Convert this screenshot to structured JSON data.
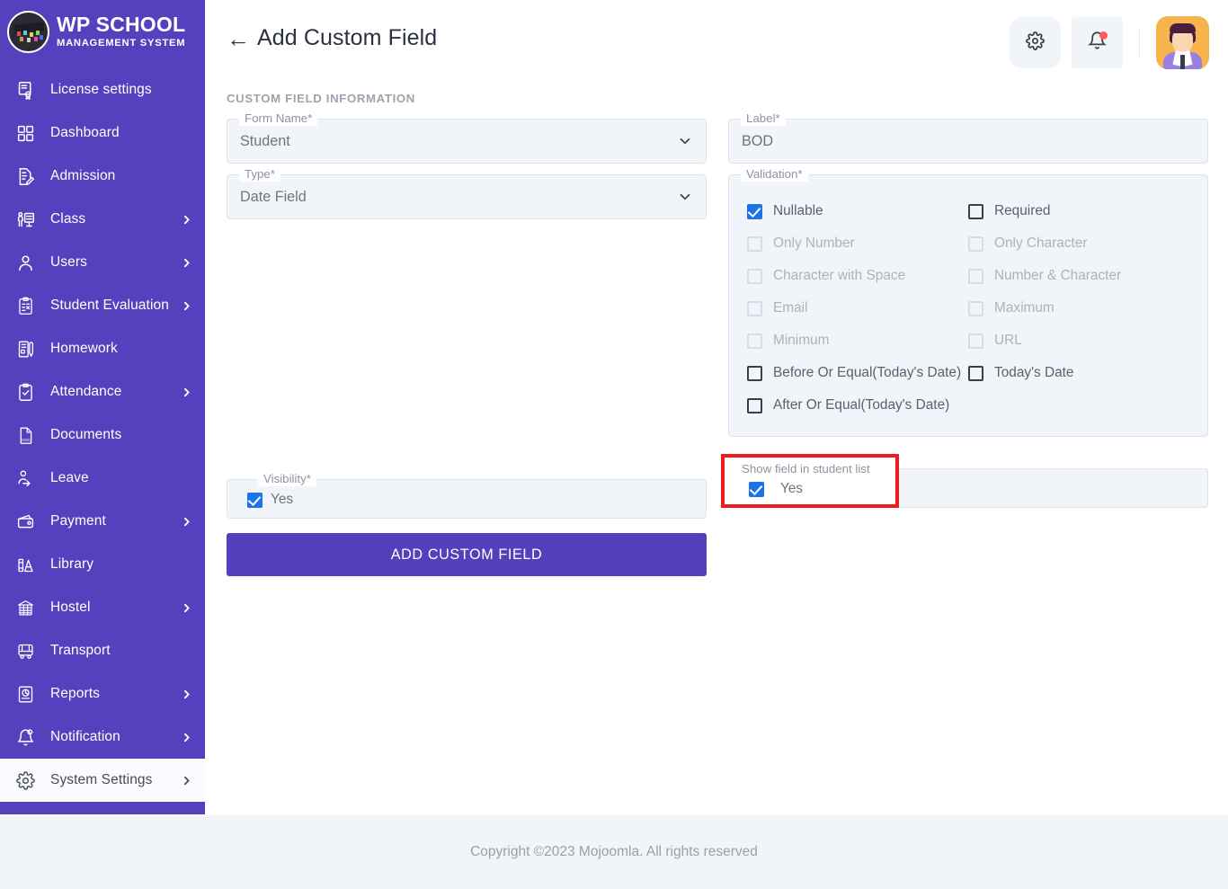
{
  "brand": {
    "title": "WP SCHOOL",
    "subtitle": "MANAGEMENT SYSTEM",
    "logo_icon": "graduation-cap-logo"
  },
  "sidebar": {
    "items": [
      {
        "label": "License settings",
        "icon": "certificate-icon",
        "chevron": false,
        "active": false
      },
      {
        "label": "Dashboard",
        "icon": "grid-squares-icon",
        "chevron": false,
        "active": false
      },
      {
        "label": "Admission",
        "icon": "document-edit-icon",
        "chevron": false,
        "active": false
      },
      {
        "label": "Class",
        "icon": "classroom-icon",
        "chevron": true,
        "active": false
      },
      {
        "label": "Users",
        "icon": "user-icon",
        "chevron": true,
        "active": false
      },
      {
        "label": "Student Evaluation",
        "icon": "clipboard-check-icon",
        "chevron": true,
        "active": false
      },
      {
        "label": "Homework",
        "icon": "book-pencil-icon",
        "chevron": false,
        "active": false
      },
      {
        "label": "Attendance",
        "icon": "clipboard-tick-icon",
        "chevron": true,
        "active": false
      },
      {
        "label": "Documents",
        "icon": "doc-file-icon",
        "chevron": false,
        "active": false
      },
      {
        "label": "Leave",
        "icon": "user-logout-icon",
        "chevron": false,
        "active": false
      },
      {
        "label": "Payment",
        "icon": "wallet-icon",
        "chevron": true,
        "active": false
      },
      {
        "label": "Library",
        "icon": "books-icon",
        "chevron": false,
        "active": false
      },
      {
        "label": "Hostel",
        "icon": "hostel-building-icon",
        "chevron": true,
        "active": false
      },
      {
        "label": "Transport",
        "icon": "bus-icon",
        "chevron": false,
        "active": false
      },
      {
        "label": "Reports",
        "icon": "report-chart-icon",
        "chevron": true,
        "active": false
      },
      {
        "label": "Notification",
        "icon": "bell-icon",
        "chevron": true,
        "active": false
      },
      {
        "label": "System Settings",
        "icon": "gear-icon",
        "chevron": true,
        "active": true
      }
    ]
  },
  "header": {
    "back_arrow": "←",
    "title": "Add Custom Field",
    "settings_icon": "gear-icon",
    "notification_icon": "bell-icon",
    "notification_dot": true,
    "avatar_icon": "user-avatar"
  },
  "main": {
    "section_title": "CUSTOM FIELD INFORMATION",
    "form_name": {
      "legend": "Form Name*",
      "value": "Student",
      "chevron_icon": "chevron-down-icon"
    },
    "type": {
      "legend": "Type*",
      "value": "Date Field",
      "chevron_icon": "chevron-down-icon"
    },
    "label": {
      "legend": "Label*",
      "value": "BOD",
      "placeholder": "Label"
    },
    "validation": {
      "legend": "Validation*",
      "options": [
        {
          "label": "Nullable",
          "checked": true,
          "disabled": false
        },
        {
          "label": "Required",
          "checked": false,
          "disabled": false
        },
        {
          "label": "Only Number",
          "checked": false,
          "disabled": true
        },
        {
          "label": "Only Character",
          "checked": false,
          "disabled": true
        },
        {
          "label": "Character with Space",
          "checked": false,
          "disabled": true
        },
        {
          "label": "Number & Character",
          "checked": false,
          "disabled": true
        },
        {
          "label": "Email",
          "checked": false,
          "disabled": true
        },
        {
          "label": "Maximum",
          "checked": false,
          "disabled": true
        },
        {
          "label": "Minimum",
          "checked": false,
          "disabled": true
        },
        {
          "label": "URL",
          "checked": false,
          "disabled": true
        },
        {
          "label": "Before Or Equal(Today's Date)",
          "checked": false,
          "disabled": false
        },
        {
          "label": "Today's Date",
          "checked": false,
          "disabled": false
        },
        {
          "label": "After Or Equal(Today's Date)",
          "checked": false,
          "disabled": false
        }
      ]
    },
    "visibility": {
      "legend": "Visibility*",
      "option_label": "Yes",
      "checked": true
    },
    "show_in_student_list": {
      "legend": "Show field in student list",
      "option_label": "Yes",
      "checked": true,
      "highlight_color": "#EE1C1C"
    },
    "submit_button": "ADD CUSTOM FIELD"
  },
  "footer": {
    "copyright": "Copyright ©2023 Mojoomla. All rights reserved"
  },
  "colors": {
    "sidebar": "#5341BE",
    "primary": "#5340BC",
    "checkbox_blue": "#1A73E8",
    "field_bg": "#F1F4F9",
    "highlight_red": "#EE1C1C"
  }
}
